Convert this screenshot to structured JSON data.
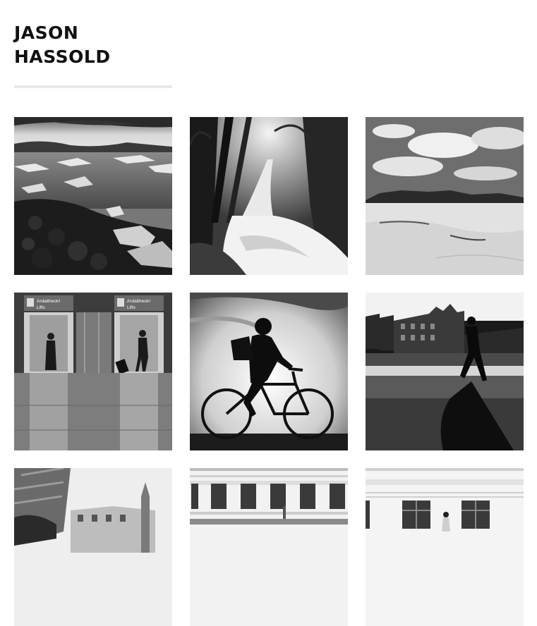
{
  "site": {
    "title_line1": "JASON",
    "title_line2": "HASSOLD"
  },
  "gallery": {
    "photos": [
      {
        "subject": "glacier lagoon with ice chunks on rocky shore"
      },
      {
        "subject": "long exposure waterfall in a forest"
      },
      {
        "subject": "dunes with mountains and cloudy sky"
      },
      {
        "subject": "airport elevators with travellers",
        "visible_text": [
          "Ardaitheoirí",
          "Lifts",
          "Ardaitheoirí",
          "Lifts"
        ]
      },
      {
        "subject": "silhouette of cyclist against bright sky"
      },
      {
        "subject": "silhouette of pedestrian walking past buildings"
      },
      {
        "subject": "street view with historic building"
      },
      {
        "subject": "white facade with windows"
      },
      {
        "subject": "facade with windows and a pedestrian"
      }
    ]
  }
}
